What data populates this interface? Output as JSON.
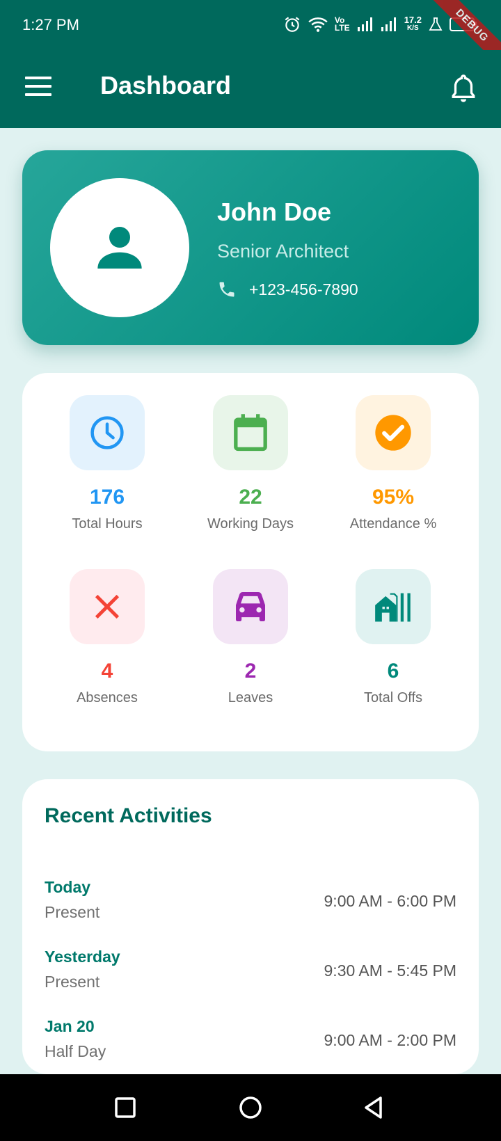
{
  "status_bar": {
    "time": "1:27 PM",
    "network_speed": "17.2",
    "network_speed_unit": "K/S",
    "debug_label": "DEBUG",
    "icons": [
      "alarm-icon",
      "wifi-icon",
      "volte-icon",
      "signal-icon",
      "signal-icon",
      "lab-icon",
      "battery-icon"
    ]
  },
  "app_bar": {
    "title": "Dashboard",
    "icons": [
      "menu-icon",
      "bell-icon"
    ]
  },
  "profile": {
    "name": "John Doe",
    "role": "Senior Architect",
    "phone": "+123-456-7890",
    "icons": [
      "person-icon",
      "phone-icon"
    ]
  },
  "stats": [
    {
      "value": "176",
      "label": "Total Hours",
      "icon": "clock-icon",
      "color": "#2196f3",
      "bg": "#e3f2fd"
    },
    {
      "value": "22",
      "label": "Working Days",
      "icon": "calendar-icon",
      "color": "#4caf50",
      "bg": "#e8f5e9"
    },
    {
      "value": "95%",
      "label": "Attendance %",
      "icon": "check-circle-icon",
      "color": "#ff9800",
      "bg": "#fff3e0"
    },
    {
      "value": "4",
      "label": "Absences",
      "icon": "close-icon",
      "color": "#f44336",
      "bg": "#ffebee"
    },
    {
      "value": "2",
      "label": "Leaves",
      "icon": "car-icon",
      "color": "#9c27b0",
      "bg": "#f3e5f5"
    },
    {
      "value": "6",
      "label": "Total Offs",
      "icon": "home-work-icon",
      "color": "#00897b",
      "bg": "#e0f2f1"
    }
  ],
  "activities": {
    "title": "Recent Activities",
    "items": [
      {
        "day": "Today",
        "status": "Present",
        "time": "9:00 AM - 6:00 PM"
      },
      {
        "day": "Yesterday",
        "status": "Present",
        "time": "9:30 AM - 5:45 PM"
      },
      {
        "day": "Jan 20",
        "status": "Half Day",
        "time": "9:00 AM - 2:00 PM"
      }
    ]
  },
  "nav_bar": {
    "icons": [
      "recents-square-icon",
      "home-circle-icon",
      "back-triangle-icon"
    ]
  },
  "colors": {
    "primary": "#00695c",
    "background": "#e0f2f1"
  }
}
